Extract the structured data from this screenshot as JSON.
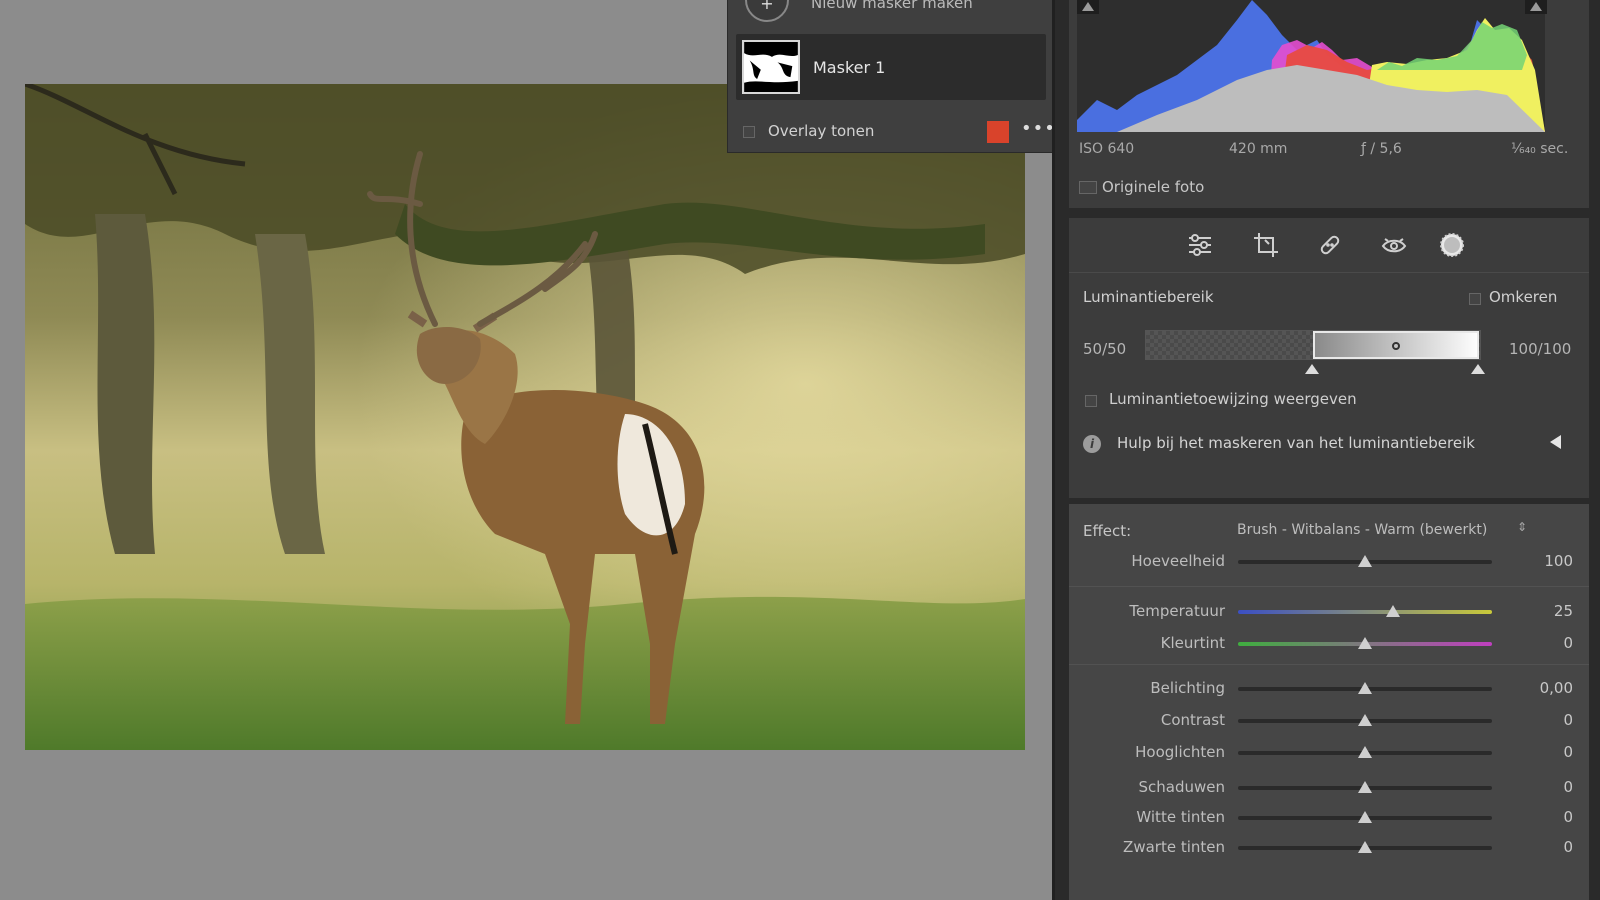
{
  "mask_panel": {
    "new_mask_label": "Nieuw masker maken",
    "mask_name": "Masker 1",
    "overlay_label": "Overlay tonen",
    "overlay_color": "#d9432b",
    "more_icon": "•••"
  },
  "histogram": {
    "iso": "ISO 640",
    "focal": "420 mm",
    "aperture": "ƒ / 5,6",
    "shutter": "¹⁄₆₄₀ sec.",
    "original_photo_label": "Originele foto"
  },
  "tools": {
    "icons": [
      "sliders-icon",
      "crop-icon",
      "healing-icon",
      "redeye-icon",
      "mask-icon"
    ]
  },
  "luminance": {
    "title": "Luminantiebereik",
    "invert_label": "Omkeren",
    "left_value": "50/50",
    "right_value": "100/100",
    "map_label": "Luminantietoewijzing weergeven",
    "help_label": "Hulp bij het maskeren van het luminantiebereik"
  },
  "effect": {
    "label": "Effect:",
    "value": "Brush - Witbalans - Warm (bewerkt)",
    "sliders": [
      {
        "label": "Hoeveelheid",
        "value": "100",
        "position": 0.5
      },
      {
        "label": "Temperatuur",
        "value": "25",
        "position": 0.61
      },
      {
        "label": "Kleurtint",
        "value": "0",
        "position": 0.5
      },
      {
        "label": "Belichting",
        "value": "0,00",
        "position": 0.5
      },
      {
        "label": "Contrast",
        "value": "0",
        "position": 0.5
      },
      {
        "label": "Hooglichten",
        "value": "0",
        "position": 0.5
      },
      {
        "label": "Schaduwen",
        "value": "0",
        "position": 0.5
      },
      {
        "label": "Witte tinten",
        "value": "0",
        "position": 0.5
      },
      {
        "label": "Zwarte tinten",
        "value": "0",
        "position": 0.5
      }
    ]
  },
  "colors": {
    "temperature_track": [
      "#3b4fc4",
      "#c9c93a"
    ],
    "tint_track": [
      "#3fae3f",
      "#c03fc0"
    ]
  }
}
